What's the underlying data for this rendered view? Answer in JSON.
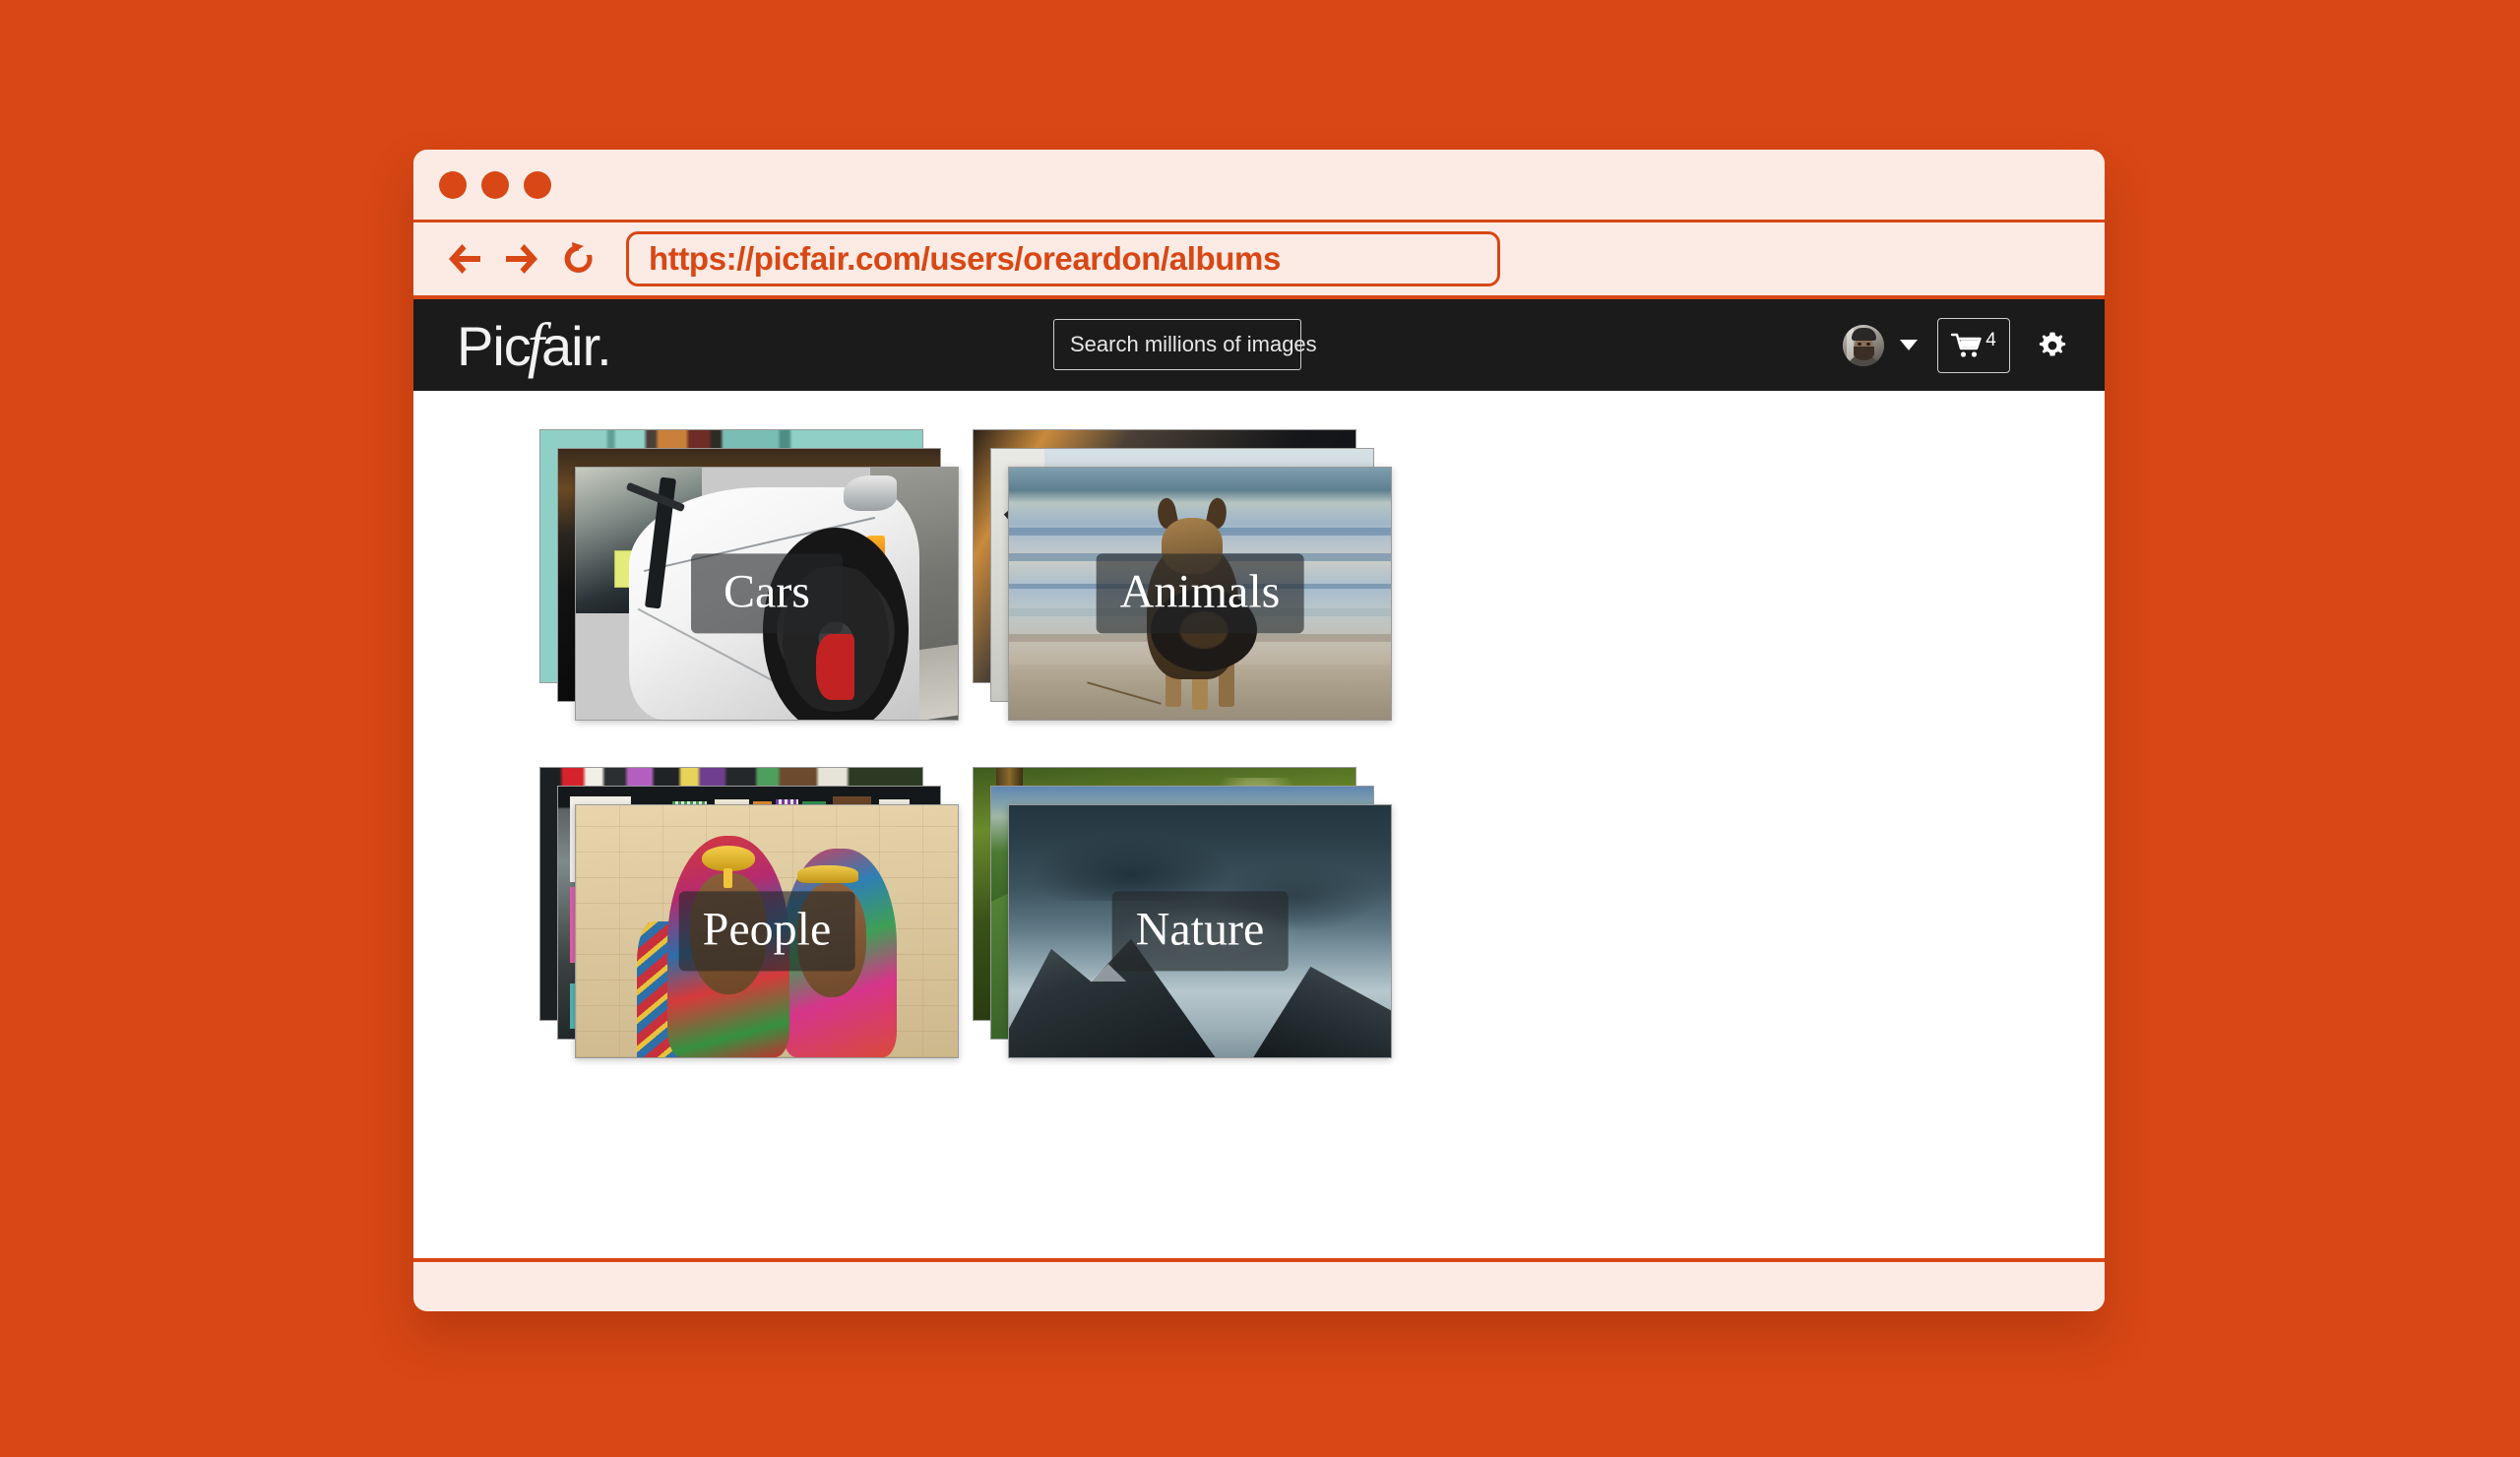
{
  "window": {
    "traffic_lights": [
      "close",
      "minimize",
      "maximize"
    ]
  },
  "browser": {
    "back_icon": "arrow-left-icon",
    "forward_icon": "arrow-right-icon",
    "reload_icon": "reload-icon",
    "url": "https://picfair.com/users/oreardon/albums"
  },
  "site_header": {
    "logo": {
      "part1": "Pic",
      "part2": "f",
      "part3": "air."
    },
    "search": {
      "placeholder": "Search millions of images",
      "value": "",
      "icon": "search-icon"
    },
    "account": {
      "avatar_alt": "user-avatar",
      "caret_icon": "chevron-down-icon"
    },
    "cart": {
      "icon": "shopping-cart-icon",
      "count": "4"
    },
    "settings": {
      "icon": "gear-icon"
    }
  },
  "albums": [
    {
      "title": "Cars",
      "art": "cars"
    },
    {
      "title": "Animals",
      "art": "animals"
    },
    {
      "title": "People",
      "art": "people"
    },
    {
      "title": "Nature",
      "art": "nature"
    }
  ],
  "colors": {
    "page_background": "#d84715",
    "window_chrome": "#fbebe4",
    "accent": "#d84715",
    "site_header": "#1b1b1b",
    "content_background": "#ffffff",
    "label_overlay": "rgba(36,38,40,0.62)"
  }
}
